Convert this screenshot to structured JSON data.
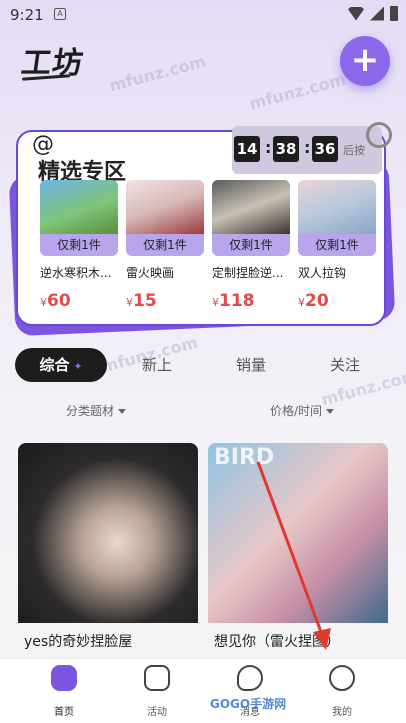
{
  "status_bar": {
    "time": "9:21",
    "notif": "A"
  },
  "header": {
    "title": "工坊",
    "add_label": "+"
  },
  "featured": {
    "title": "精选专区",
    "countdown": {
      "h": "14",
      "m": "38",
      "s": "36",
      "suffix": "后按"
    },
    "items": [
      {
        "name": "逆水寒积木...",
        "tag": "仅剩1件",
        "price": "60",
        "currency": "¥"
      },
      {
        "name": "雷火映画",
        "tag": "仅剩1件",
        "price": "15",
        "currency": "¥"
      },
      {
        "name": "定制捏脸逆...",
        "tag": "仅剩1件",
        "price": "118",
        "currency": "¥"
      },
      {
        "name": "双人拉钩",
        "tag": "仅剩1件",
        "price": "20",
        "currency": "¥"
      }
    ]
  },
  "tabs": [
    "综合",
    "新上",
    "销量",
    "关注"
  ],
  "filters": {
    "category": "分类题材",
    "sort": "价格/时间"
  },
  "posts": [
    {
      "title": "yes的奇妙捏脸屋"
    },
    {
      "title": "想见你（雷火捏图）",
      "overlay_text": "BIRD"
    }
  ],
  "bottom_nav": [
    {
      "label": "首页",
      "icon": "home-icon"
    },
    {
      "label": "活动",
      "icon": "activity-icon"
    },
    {
      "label": "消息",
      "icon": "message-icon"
    },
    {
      "label": "我的",
      "icon": "profile-icon"
    }
  ],
  "watermarks": [
    "mfunz.com",
    "GOGO手游网"
  ],
  "colors": {
    "accent": "#7b55e0",
    "price": "#e34a4a",
    "dark": "#1d1d1d"
  }
}
